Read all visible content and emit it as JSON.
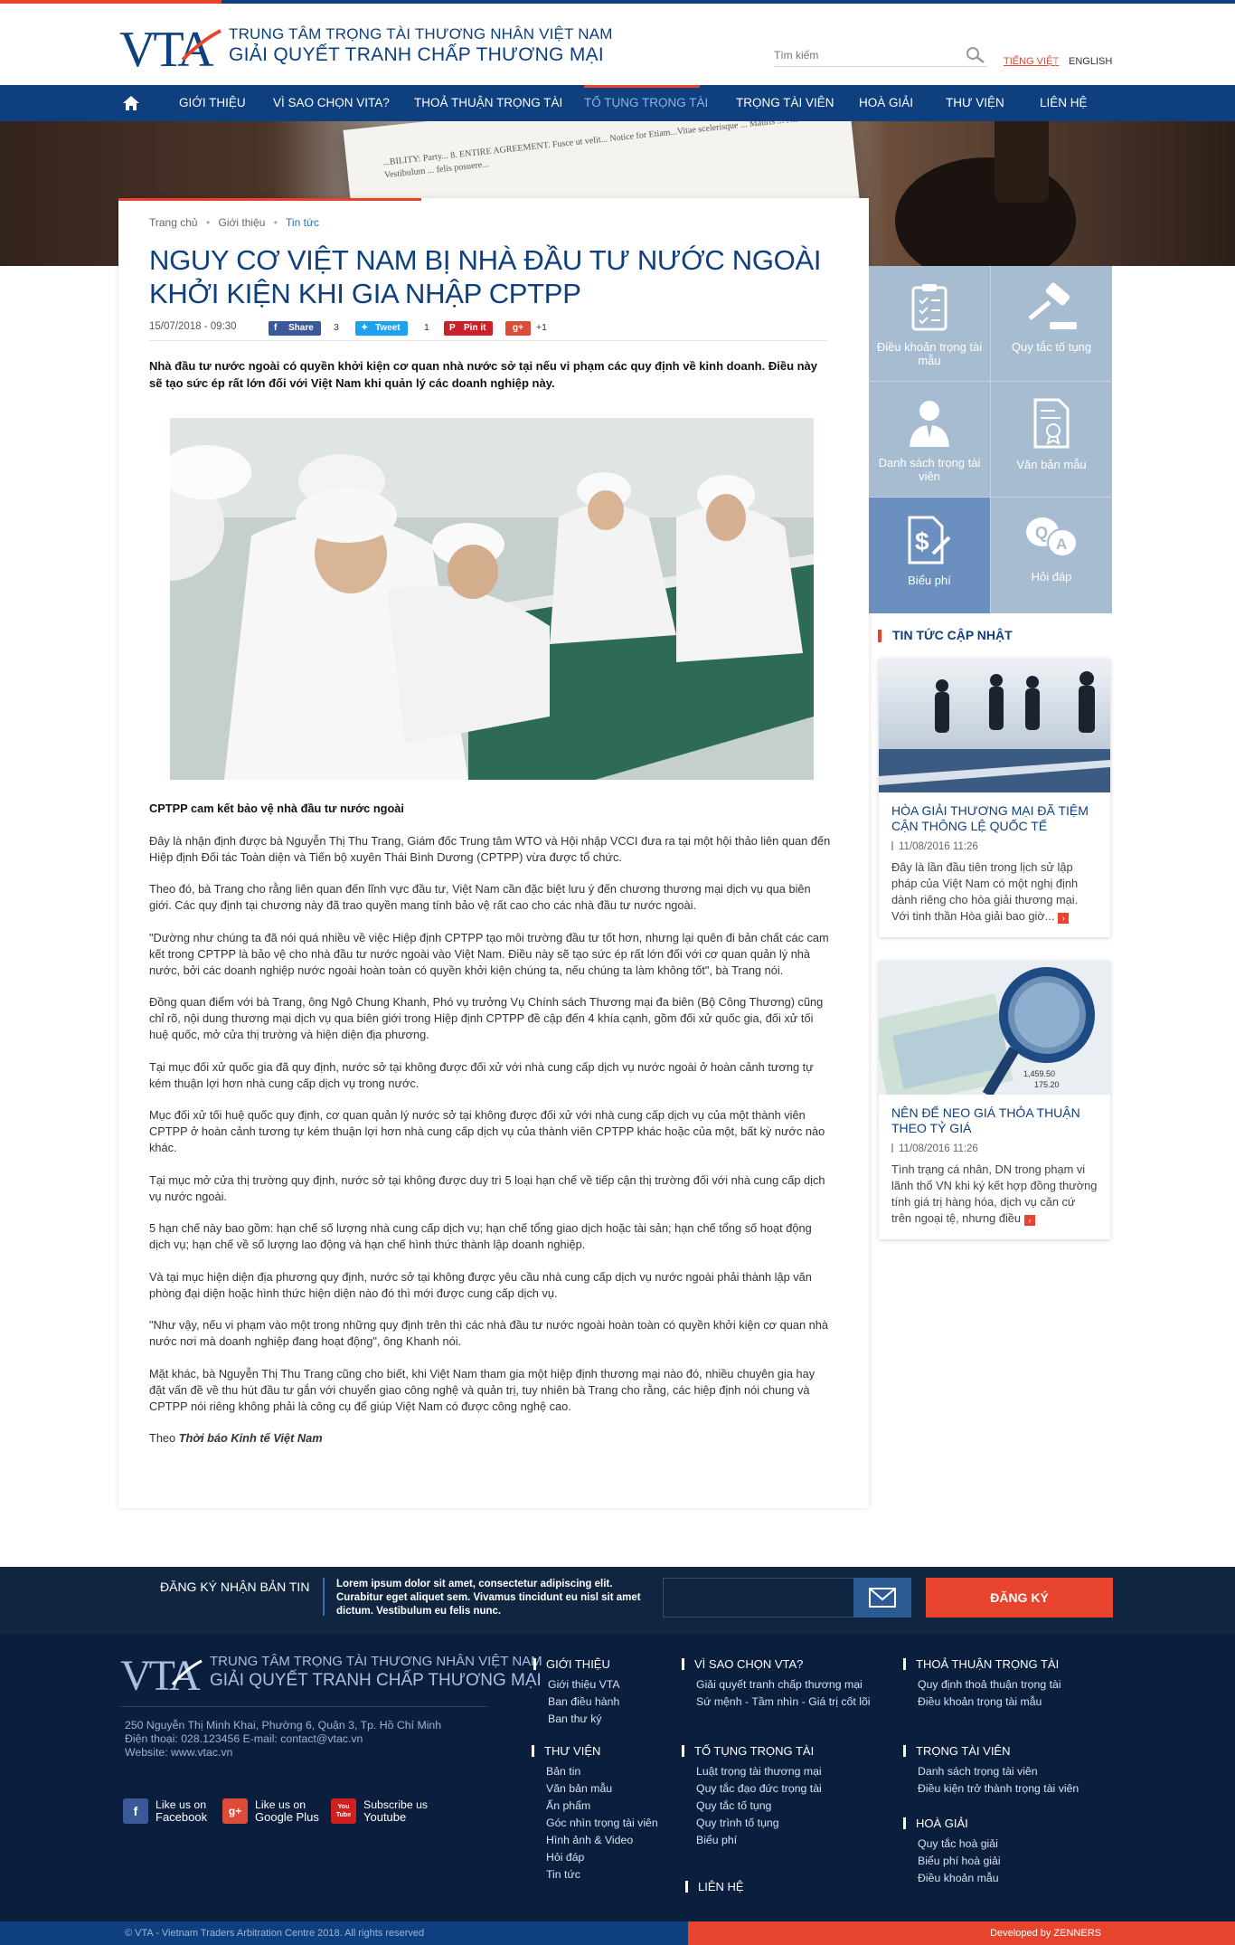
{
  "header": {
    "brand_line1": "TRUNG TÂM TRỌNG TÀI THƯƠNG NHÂN VIỆT NAM",
    "brand_line2": "GIẢI QUYẾT TRANH CHẤP THƯƠNG MẠI",
    "logo_text": "VTA",
    "search_placeholder": "Tìm kiếm",
    "lang_vi": "TIẾNG VIỆT",
    "lang_sep": "|",
    "lang_en": "ENGLISH"
  },
  "nav": {
    "items": [
      {
        "label": "GIỚI THIỆU"
      },
      {
        "label": "VÌ SAO CHỌN VITA?"
      },
      {
        "label": "THOẢ THUẬN TRỌNG TÀI"
      },
      {
        "label": "TỐ TỤNG TRỌNG TÀI"
      },
      {
        "label": "TRỌNG TÀI VIÊN"
      },
      {
        "label": "HOÀ GIẢI"
      },
      {
        "label": "THƯ VIỆN"
      },
      {
        "label": "LIÊN HỆ"
      }
    ],
    "active_index": 3
  },
  "hero": {
    "paper_text": "...BILITY: Party... 8. ENTIRE AGREEMENT. Fusce ut velit... Notice for Etiam...Vitae scelerisque ... Mauris ... Nisi ... Vestibulum ... felis posuere..."
  },
  "breadcrumb": {
    "items": [
      "Trang chủ",
      "Giới thiệu",
      "Tin tức"
    ]
  },
  "article": {
    "title": "NGUY CƠ VIỆT NAM BỊ NHÀ ĐẦU TƯ NƯỚC NGOÀI KHỞI KIỆN KHI GIA NHẬP CPTPP",
    "date": "15/07/2018 - 09:30",
    "share": {
      "facebook_label": "Share",
      "facebook_count": "3",
      "twitter_label": "Tweet",
      "twitter_count": "1",
      "pinterest_label": "Pin it",
      "gplus_label": "g+",
      "gplus_count": "+1"
    },
    "lead": "Nhà đầu tư nước ngoài có quyền khởi kiện cơ quan nhà nước sở tại nếu vi phạm các quy định về kinh doanh. Điều này sẽ tạo sức ép rất lớn đối với Việt Nam khi quản lý các doanh nghiệp này.",
    "subheading": "CPTPP cam kết bảo vệ nhà đầu tư nước ngoài",
    "paragraphs": [
      "Đây là nhận định được bà Nguyễn Thị Thu Trang, Giám đốc Trung tâm WTO và Hội nhập VCCI đưa ra tại một hội thảo liên quan đến Hiệp định Đối tác Toàn diện và Tiến bộ xuyên Thái Bình Dương (CPTPP) vừa được tổ chức.",
      "Theo đó, bà Trang cho rằng liên quan đến lĩnh vực đầu tư, Việt Nam cần đặc biệt lưu ý đến chương thương mại dịch vụ qua biên giới. Các quy định tại chương này đã trao quyền mang tính bảo vệ rất cao cho các nhà đầu tư nước ngoài.",
      "\"Dường như chúng ta đã nói quá nhiều về việc Hiệp định CPTPP tạo môi trường đầu tư tốt hơn, nhưng lại quên đi bản chất các cam kết trong CPTPP là bảo vệ cho nhà đầu tư nước ngoài vào Việt Nam. Điều này sẽ tạo sức ép rất lớn đối với cơ quan quản lý nhà nước, bởi các doanh nghiệp nước ngoài hoàn toàn có quyền khởi kiện chúng ta, nếu chúng ta làm không tốt\", bà Trang nói.",
      "Đồng quan điểm với bà Trang, ông Ngô Chung Khanh, Phó vụ trưởng Vụ Chính sách Thương mại đa biên (Bộ Công Thương) cũng chỉ rõ, nội dung thương mại dịch vụ qua biên giới trong Hiệp định CPTPP đề cập đến 4 khía cạnh, gồm đối xử quốc gia, đối xử tối huệ quốc, mở cửa thị trường và hiện diện địa phương.",
      "Tại mục đối xử quốc gia đã quy định, nước sở tại không được đối xử với nhà cung cấp dịch vụ nước ngoài ở hoàn cảnh tương tự kém thuận lợi hơn nhà cung cấp dịch vụ trong nước.",
      "Mục đối xử tối huệ quốc quy định, cơ quan quản lý nước sở tại không được đối xử với nhà cung cấp dịch vụ của một thành viên CPTPP ở hoàn cảnh tương tự kém thuận lợi hơn nhà cung cấp dịch vụ của thành viên CPTPP khác hoặc của một, bất kỳ nước nào khác.",
      "Tại mục mở cửa thị trường quy định, nước sở tại không được duy trì 5 loại hạn chế về tiếp cận thị trường đối với nhà cung cấp dịch vụ nước ngoài.",
      "5 hạn chế này bao gồm: hạn chế số lượng nhà cung cấp dịch vụ; hạn chế tổng giao dịch hoặc tài sản; hạn chế tổng số hoạt động dịch vụ; hạn chế về số lượng lao động và hạn chế hình thức thành lập doanh nghiệp.",
      "Và tại mục hiện diện địa phương quy định, nước sở tại không được yêu cầu nhà cung cấp dịch vụ nước ngoài phải thành lập văn phòng đại diện hoặc hình thức hiện diện nào đó thì mới được cung cấp dịch vụ.",
      "\"Như vậy, nếu vi phạm vào một trong những quy định trên thì các nhà đầu tư nước ngoài hoàn toàn có quyền khởi kiện cơ quan nhà nước nơi mà doanh nghiệp đang hoạt động\", ông Khanh nói.",
      "Mặt khác, bà Nguyễn Thị Thu Trang cũng cho biết, khi Việt Nam tham gia một hiệp định thương mại nào đó, nhiều chuyên gia hay đặt vấn đề về thu hút đầu tư gắn với chuyển giao công nghệ và quản trị, tuy nhiên bà Trang cho rằng, các hiệp định nói chung và CPTPP nói riêng không phải là công cụ để giúp Việt Nam có được công nghệ cao."
    ],
    "source_prefix": "Theo",
    "source_name": "Thời báo Kinh tế Việt Nam"
  },
  "sidebar": {
    "tiles": [
      {
        "label": "Điều khoản trọng tài mẫu",
        "icon": "clipboard-icon"
      },
      {
        "label": "Quy tắc tố tụng",
        "icon": "gavel-icon"
      },
      {
        "label": "Danh sách trọng tài viên",
        "icon": "person-icon"
      },
      {
        "label": "Văn bản mẫu",
        "icon": "certificate-doc-icon"
      },
      {
        "label": "Biểu phí",
        "icon": "fee-doc-icon"
      },
      {
        "label": "Hỏi đáp",
        "icon": "qa-bubbles-icon"
      }
    ],
    "active_tile": 4,
    "news_heading": "TIN TỨC CẬP NHẬT",
    "news": [
      {
        "title": "HÒA GIẢI THƯƠNG MẠI ĐÃ TIỆM CẬN THÔNG LỆ QUỐC TẾ",
        "date": "11/08/2016 11:26",
        "excerpt": "Đây là lần đầu tiên trong lịch sử lập pháp của Việt Nam có một nghị định dành riêng cho hòa giải thương mại. Với tinh thần Hòa giải bao giờ..."
      },
      {
        "title": "NÊN ĐỂ NEO GIÁ THỎA THUẬN THEO TỶ GIÁ",
        "date": "11/08/2016 11:26",
        "excerpt": "Tình trạng cá nhân, DN trong phạm vi lãnh thổ VN khi ký kết hợp đồng thường tính giá trị hàng hóa, dịch vụ căn cứ trên ngoại tệ, nhưng điều"
      }
    ]
  },
  "newsletter": {
    "label": "ĐĂNG KÝ NHẬN BẢN TIN",
    "text": "Lorem ipsum dolor sit amet, consectetur adipiscing elit. Curabitur eget aliquet sem. Vivamus tincidunt eu nisl sit amet dictum. Vestibulum eu felis nunc.",
    "input_placeholder": "",
    "button": "ĐĂNG KÝ"
  },
  "footer": {
    "brand_line1": "TRUNG TÂM TRỌNG TÀI THƯƠNG NHÂN VIỆT NAM",
    "brand_line2": "GIẢI QUYẾT TRANH CHẤP THƯƠNG MẠI",
    "address": "250 Nguyễn Thị Minh Khai, Phường 6, Quận 3, Tp. Hồ Chí Minh",
    "phone": "Điện thoại: 028.123456 E-mail: contact@vtac.vn",
    "website": "Website: www.vtac.vn",
    "social": [
      {
        "line1": "Like us on",
        "line2": "Facebook",
        "icon": "facebook-icon",
        "glyph": "f"
      },
      {
        "line1": "Like us on",
        "line2": "Google Plus",
        "icon": "google-plus-icon",
        "glyph": "g+"
      },
      {
        "line1": "Subscribe us",
        "line2": "Youtube",
        "icon": "youtube-icon",
        "glyph": "You Tube"
      }
    ],
    "columns": [
      {
        "heading": "GIỚI THIỆU",
        "items": [
          "Giới thiệu VTA",
          "Ban điều hành",
          "Ban thư ký"
        ]
      },
      {
        "heading": "VÌ SAO CHỌN VTA?",
        "items": [
          "Giải quyết tranh chấp thương mại",
          "Sứ mệnh - Tầm  nhìn - Giá trị cốt lõi"
        ]
      },
      {
        "heading": "THOẢ THUẬN TRỌNG TÀI",
        "items": [
          "Quy định thoả thuận trọng tài",
          "Điều khoản trọng tài mẫu"
        ]
      },
      {
        "heading": "THƯ VIỆN",
        "items": [
          "Bản tin",
          "Văn bản mẫu",
          "Ấn phẩm",
          "Góc nhìn trọng tài viên",
          "Hình ảnh & Video",
          "Hỏi đáp",
          "Tin tức"
        ]
      },
      {
        "heading": "TỐ TỤNG TRỌNG TÀI",
        "items": [
          "Luật trọng tài thương mại",
          "Quy tắc đạo đức trọng tài",
          "Quy tắc tố tụng",
          "Quy trình tố tụng",
          "Biểu phí"
        ]
      },
      {
        "heading": "TRỌNG TÀI VIÊN",
        "items": [
          "Danh sách trọng tài viên",
          "Điều kiện trở thành trọng tài viên"
        ]
      },
      {
        "heading": "HOÀ GIẢI",
        "items": [
          "Quy tắc hoà giải",
          "Biểu phí hoà giải",
          "Điều khoản mẫu"
        ]
      },
      {
        "heading": "LIÊN HỆ",
        "items": []
      }
    ],
    "copyright": "© VTA - Vietnam Traders Arbitration Centre  2018. All rights reserved",
    "developer": "Developed by ZENNERS"
  },
  "colors": {
    "brand_blue": "#0e3f7e",
    "accent_red": "#e8432d",
    "tile_blue": "#a7bbd1",
    "footer_navy": "#0b1e3d"
  }
}
